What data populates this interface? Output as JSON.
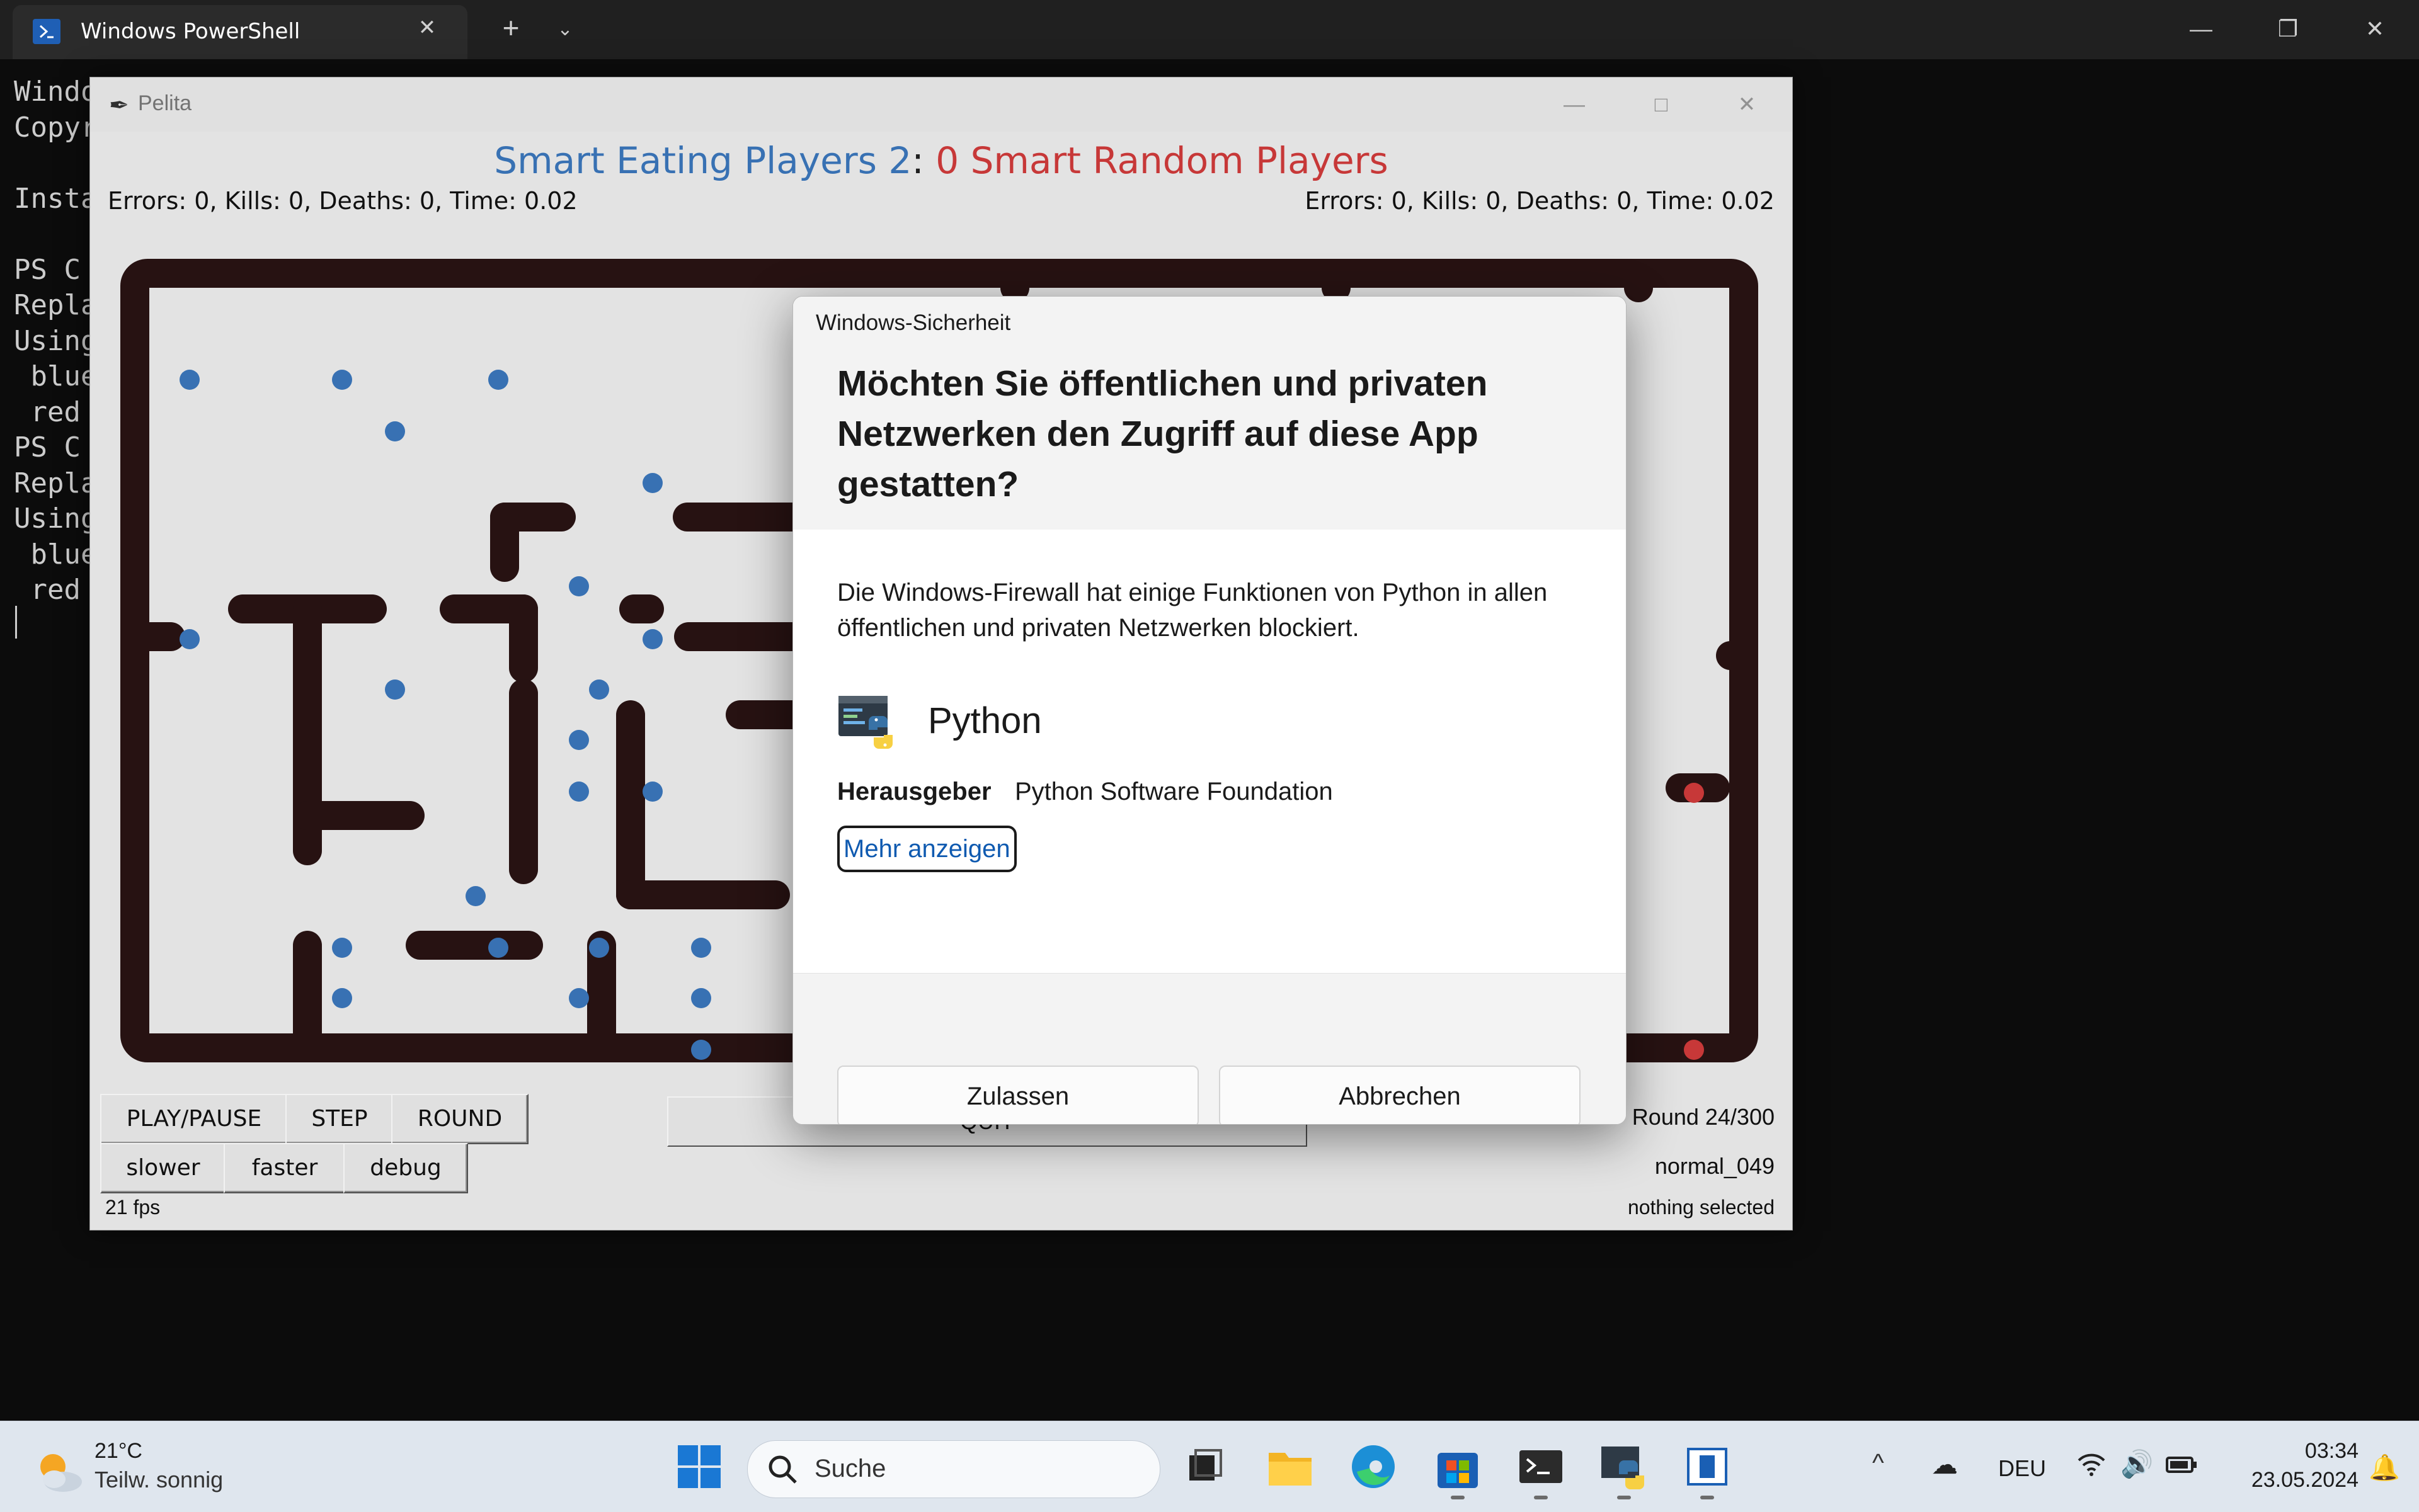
{
  "terminal": {
    "tab_title": "Windows PowerShell",
    "tab_close": "✕",
    "new_tab": "+",
    "tab_menu": "⌄",
    "lines": [
      "Windo",
      "Copyr",
      "",
      "Insta",
      "",
      "PS C",
      "Repla",
      "Using",
      " blue",
      " red",
      "PS C",
      "Repla",
      "Using",
      " blue",
      " red"
    ],
    "window_controls": {
      "minimize": "—",
      "maximize": "❐",
      "close": "✕"
    }
  },
  "pelita": {
    "window_title": "Pelita",
    "window_controls": {
      "minimize": "—",
      "maximize": "□",
      "close": "✕"
    },
    "score": {
      "blue_team": "Smart Eating Players",
      "blue_score": "2",
      "separator": ":",
      "red_score": "0",
      "red_team": "Smart Random Players"
    },
    "stats_left": "Errors: 0, Kills: 0, Deaths: 0, Time: 0.02",
    "stats_right": "Errors: 0, Kills: 0, Deaths: 0, Time: 0.02",
    "buttons": {
      "play_pause": "PLAY/PAUSE",
      "step": "STEP",
      "round": "ROUND",
      "slower": "slower",
      "faster": "faster",
      "debug": "debug",
      "quit": "QUIT"
    },
    "round_label": "Round  24/300",
    "layout_name": "normal_049",
    "fps": "21 fps",
    "selection": "nothing selected",
    "colors": {
      "wall": "#2a1414",
      "blue_food": "#3b78bd",
      "red_food": "#d23c3c"
    }
  },
  "dialog": {
    "app_title": "Windows-Sicherheit",
    "question": "Möchten Sie öffentlichen und privaten Netzwerken den Zugriff auf diese App gestatten?",
    "message": "Die Windows-Firewall hat einige Funktionen von Python in allen öffentlichen und privaten Netzwerken blockiert.",
    "app_name": "Python",
    "publisher_label": "Herausgeber",
    "publisher_value": "Python Software Foundation",
    "more_link": "Mehr anzeigen",
    "allow_button": "Zulassen",
    "cancel_button": "Abbrechen"
  },
  "taskbar": {
    "weather_temp": "21°C",
    "weather_desc": "Teilw. sonnig",
    "search_placeholder": "Suche",
    "apps": [
      "task-view",
      "file-explorer",
      "edge",
      "store",
      "terminal",
      "python",
      "pelita"
    ],
    "tray_chevron": "^",
    "language": "DEU",
    "time": "03:34",
    "date": "23.05.2024"
  }
}
